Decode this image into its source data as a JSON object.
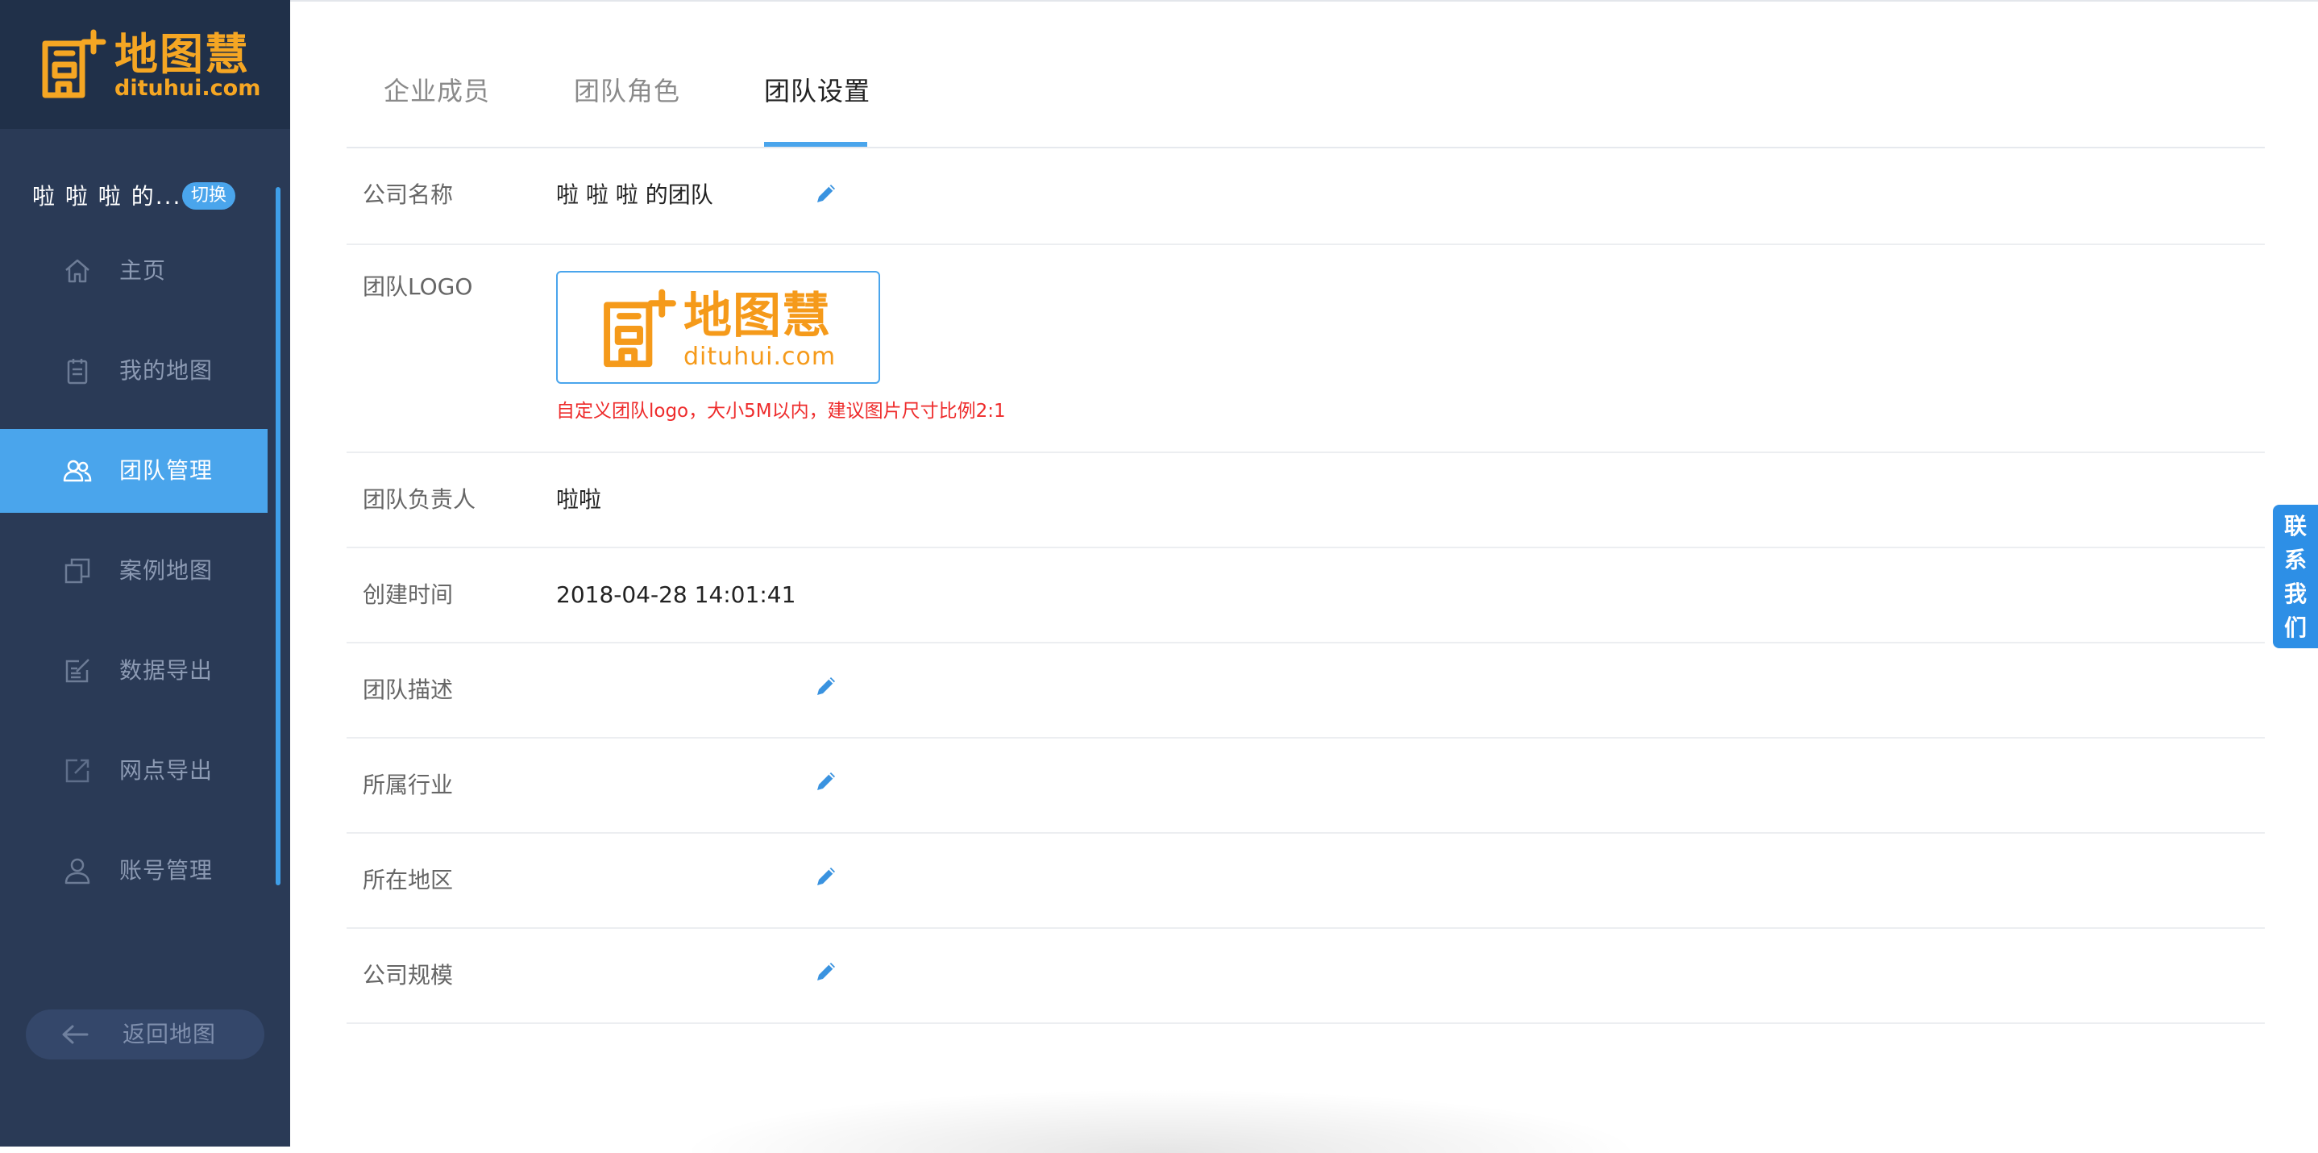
{
  "brand": {
    "name_cn": "地图慧",
    "name_en": "dituhui.com",
    "color": "#f5a623"
  },
  "sidebar": {
    "team_name": "啦 啦 啦 的...",
    "switch_label": "切换",
    "items": [
      {
        "label": "主页",
        "icon": "home-icon",
        "active": false
      },
      {
        "label": "我的地图",
        "icon": "clipboard-icon",
        "active": false
      },
      {
        "label": "团队管理",
        "icon": "users-icon",
        "active": true
      },
      {
        "label": "案例地图",
        "icon": "copy-icon",
        "active": false
      },
      {
        "label": "数据导出",
        "icon": "export-icon",
        "active": false
      },
      {
        "label": "网点导出",
        "icon": "share-icon",
        "active": false
      },
      {
        "label": "账号管理",
        "icon": "user-icon",
        "active": false
      }
    ],
    "back_label": "返回地图",
    "bg_color": "#2a3a56",
    "active_color": "#4aa5ec"
  },
  "tabs": [
    {
      "label": "企业成员",
      "active": false
    },
    {
      "label": "团队角色",
      "active": false
    },
    {
      "label": "团队设置",
      "active": true
    }
  ],
  "settings": {
    "company_name": {
      "label": "公司名称",
      "value": "啦 啦 啦 的团队"
    },
    "team_logo": {
      "label": "团队LOGO",
      "logo_cn": "地图慧",
      "logo_en": "dituhui.com",
      "hint": "自定义团队logo，大小5M以内，建议图片尺寸比例2:1"
    },
    "owner": {
      "label": "团队负责人",
      "value": "啦啦"
    },
    "created": {
      "label": "创建时间",
      "value": "2018-04-28 14:01:41"
    },
    "description": {
      "label": "团队描述",
      "value": ""
    },
    "industry": {
      "label": "所属行业",
      "value": ""
    },
    "region": {
      "label": "所在地区",
      "value": ""
    },
    "scale": {
      "label": "公司规模",
      "value": ""
    }
  },
  "contact": {
    "chars": [
      "联",
      "系",
      "我",
      "们"
    ],
    "color": "#2d8fe6"
  },
  "accent_color": "#4aa5ec",
  "hint_color": "#ee2b2b"
}
